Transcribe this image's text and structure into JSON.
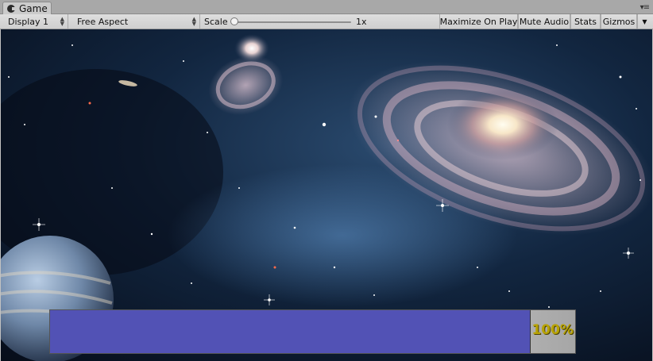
{
  "window": {
    "tab_label": "Game",
    "tab_icon": "pacman-game-icon",
    "panel_menu_glyph": "▾≡"
  },
  "toolbar": {
    "display_select": "Display 1",
    "aspect_select": "Free Aspect",
    "scale_label": "Scale",
    "scale_value": "1x",
    "maximize_on_play": "Maximize On Play",
    "mute_audio": "Mute Audio",
    "stats": "Stats",
    "gizmos": "Gizmos"
  },
  "game": {
    "background": "galaxy-space-image",
    "progress": {
      "value": 0.915,
      "label": "100%",
      "fill_color": "#5252b5",
      "label_color": "#b8a300"
    }
  }
}
